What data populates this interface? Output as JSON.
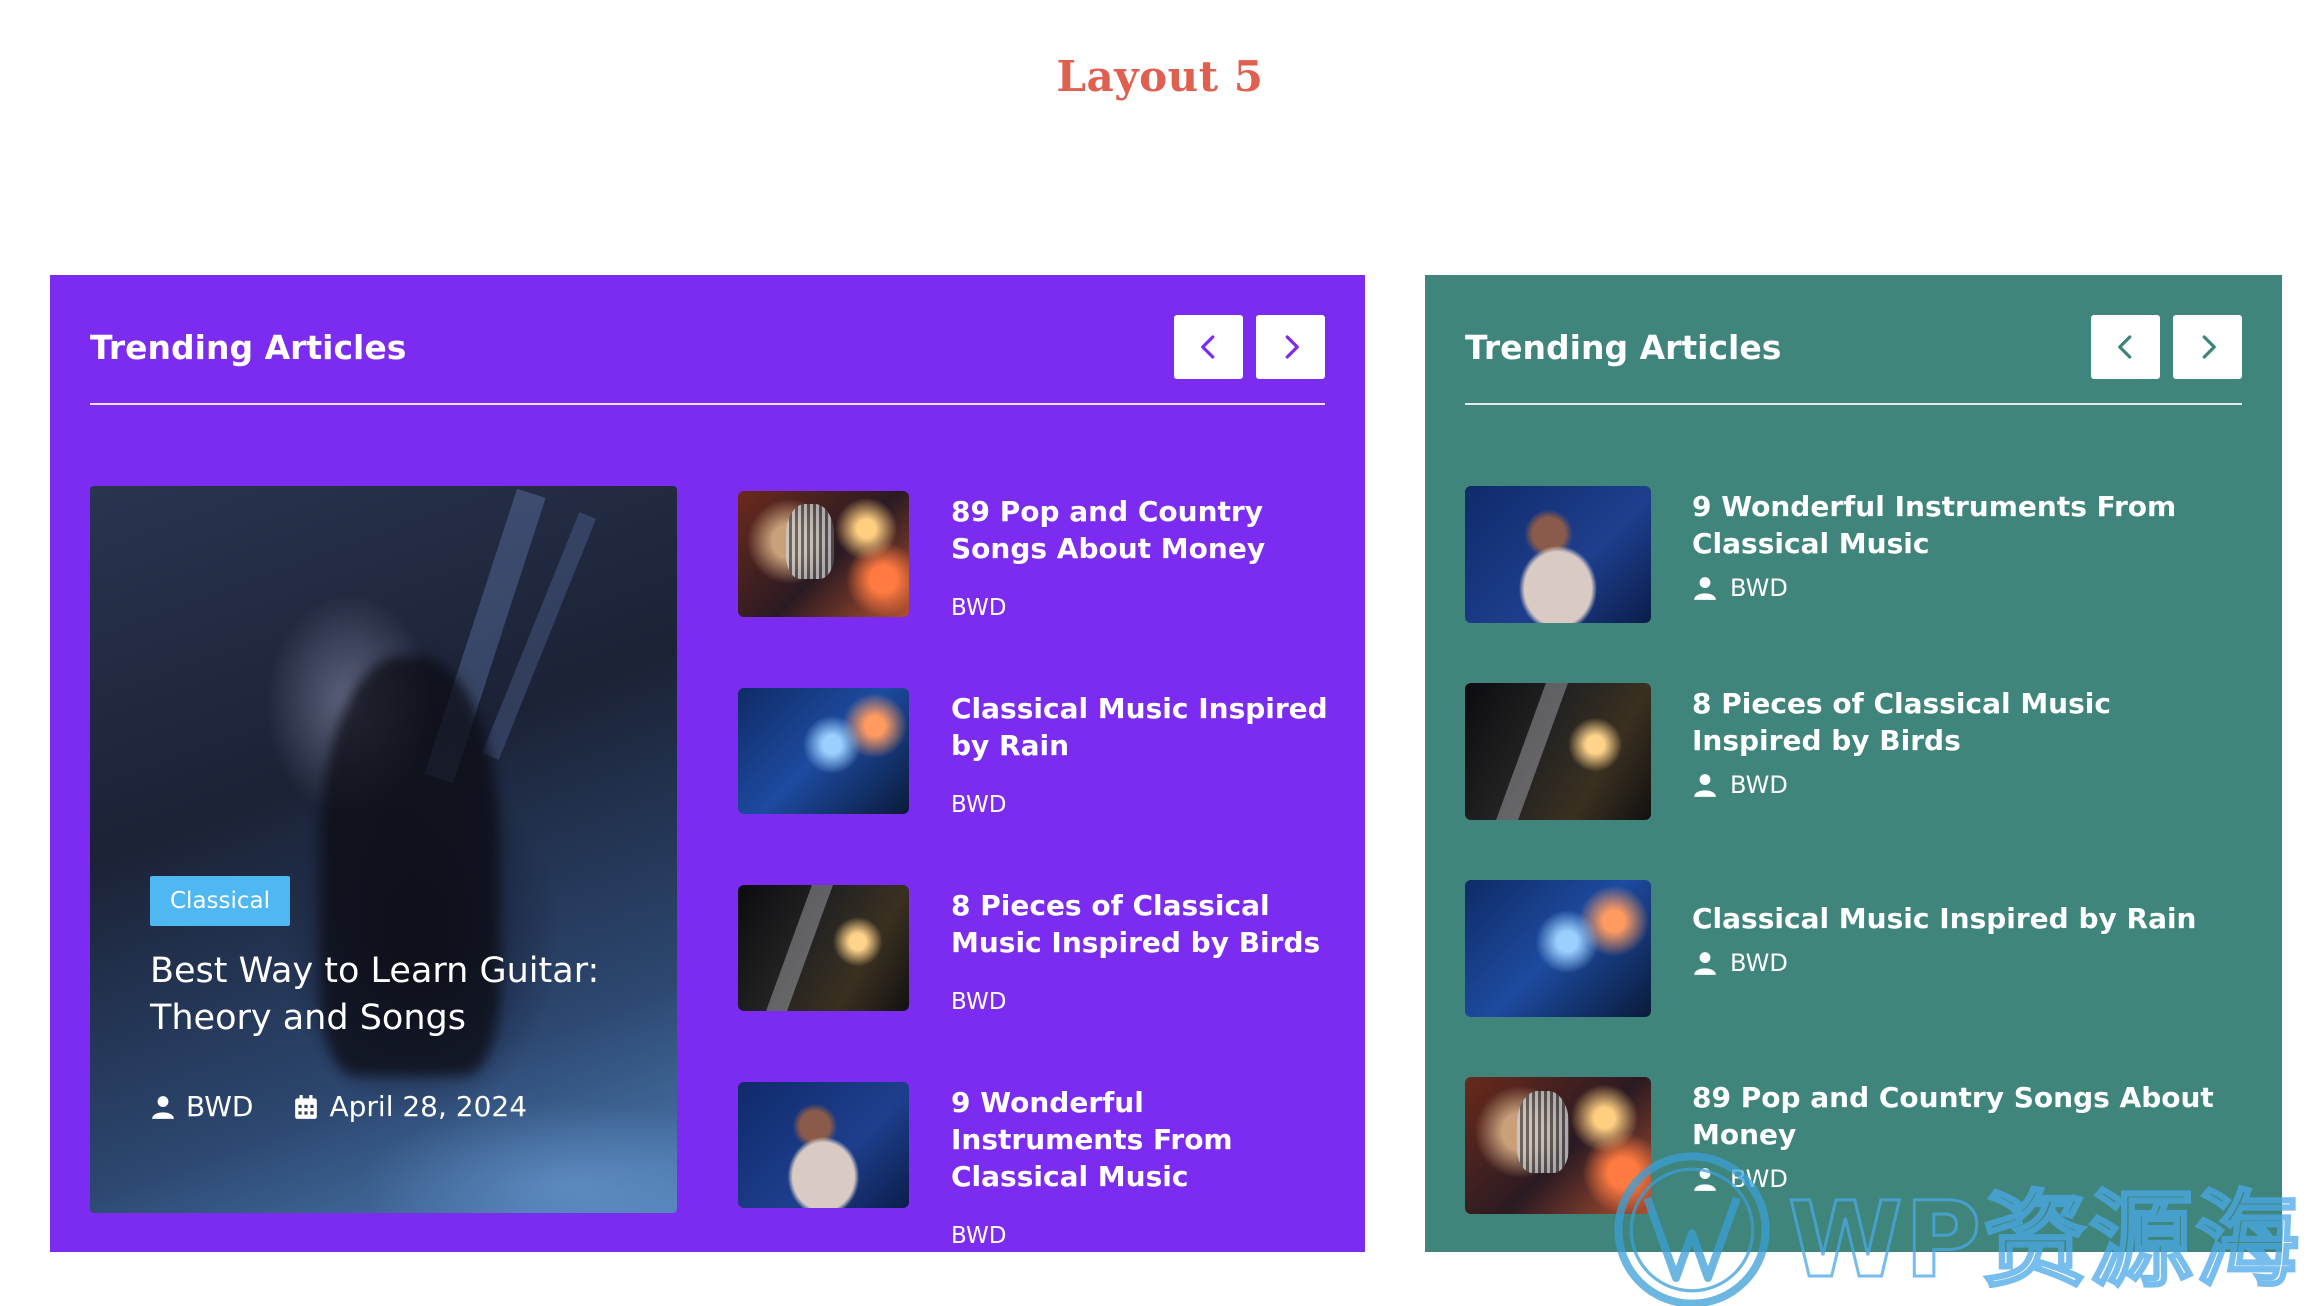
{
  "page": {
    "title": "Layout 5"
  },
  "colors": {
    "title": "#e0604f",
    "purple_card": "#7b2cf0",
    "teal_card": "#40857b",
    "badge": "#4fb7f2"
  },
  "left_card": {
    "title": "Trending Articles",
    "prev_icon": "chevron-left-icon",
    "next_icon": "chevron-right-icon",
    "featured": {
      "badge": "Classical",
      "title": "Best Way to Learn Guitar: Theory and Songs",
      "author": "BWD",
      "date": "April 28, 2024"
    },
    "items": [
      {
        "title": "89 Pop and Country Songs About Money",
        "author": "BWD"
      },
      {
        "title": "Classical Music Inspired by Rain",
        "author": "BWD"
      },
      {
        "title": "8 Pieces of Classical Music Inspired by Birds",
        "author": "BWD"
      },
      {
        "title": "9 Wonderful Instruments From Classical Music",
        "author": "BWD"
      }
    ]
  },
  "right_card": {
    "title": "Trending Articles",
    "prev_icon": "chevron-left-icon",
    "next_icon": "chevron-right-icon",
    "items": [
      {
        "title": "9 Wonderful Instruments From Classical Music",
        "author": "BWD"
      },
      {
        "title": "8 Pieces of Classical Music Inspired by Birds",
        "author": "BWD"
      },
      {
        "title": "Classical Music Inspired by Rain",
        "author": "BWD"
      },
      {
        "title": "89 Pop and Country Songs About Money",
        "author": "BWD"
      }
    ]
  },
  "watermark": {
    "text": "WP资源海"
  }
}
